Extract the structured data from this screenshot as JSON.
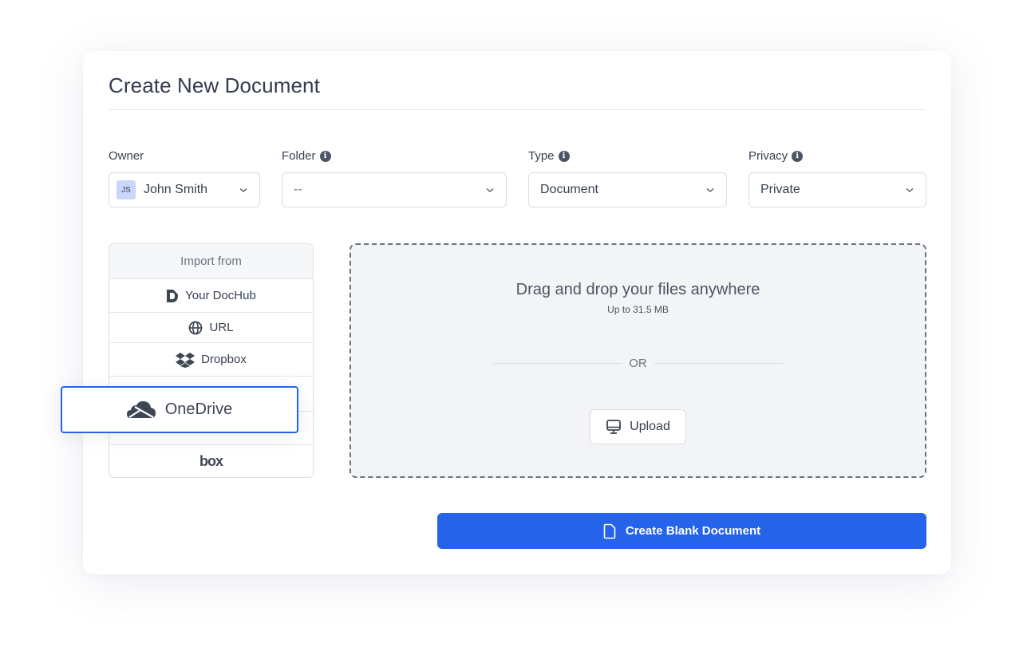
{
  "dialog": {
    "title": "Create New Document"
  },
  "fields": {
    "owner": {
      "label": "Owner",
      "initials": "JS",
      "value": "John Smith"
    },
    "folder": {
      "label": "Folder",
      "value": "--"
    },
    "type": {
      "label": "Type",
      "value": "Document"
    },
    "privacy": {
      "label": "Privacy",
      "value": "Private"
    }
  },
  "import": {
    "header": "Import from",
    "items": [
      {
        "label": "Your DocHub",
        "icon": "dochub-icon"
      },
      {
        "label": "URL",
        "icon": "globe-icon"
      },
      {
        "label": "Dropbox",
        "icon": "dropbox-icon"
      },
      {
        "label": "",
        "icon": ""
      },
      {
        "label": "",
        "icon": ""
      },
      {
        "label": "box",
        "icon": "box-logo"
      }
    ],
    "dragging": {
      "label": "OneDrive",
      "icon": "onedrive-icon"
    }
  },
  "dropzone": {
    "title": "Drag and drop your files anywhere",
    "subtitle": "Up to 31.5 MB",
    "or": "OR",
    "upload_label": "Upload"
  },
  "actions": {
    "create_blank_label": "Create Blank Document"
  },
  "colors": {
    "accent": "#2563eb",
    "dropzone_bg": "#f3f4f6",
    "avatar_bg": "#c9d7fb"
  }
}
